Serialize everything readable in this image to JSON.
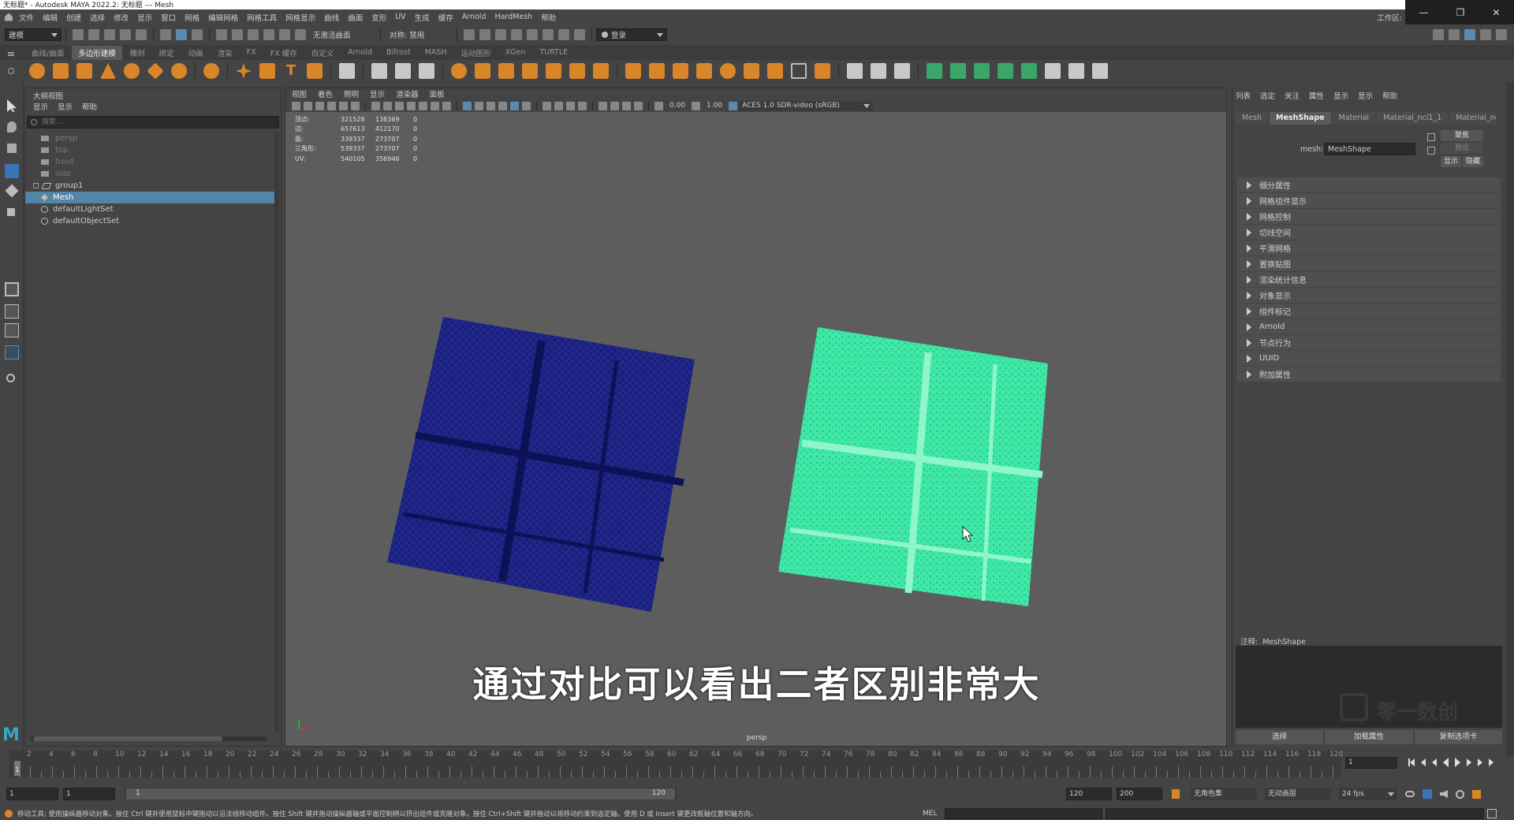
{
  "window": {
    "title": "无标题* - Autodesk MAYA 2022.2: 无标题   ---   Mesh",
    "workspace_label": "工作区:",
    "controls": [
      "—",
      "❐",
      "✕"
    ]
  },
  "menubar": [
    "文件",
    "编辑",
    "创建",
    "选择",
    "修改",
    "显示",
    "窗口",
    "网格",
    "编辑网格",
    "网格工具",
    "网格显示",
    "曲线",
    "曲面",
    "变形",
    "UV",
    "生成",
    "缓存",
    "Arnold",
    "HardMesh",
    "帮助"
  ],
  "status_line": {
    "mode": "建模",
    "live_surface": "无激活曲面",
    "symmetry": "对称: 禁用",
    "login": "登录"
  },
  "shelf_tabs": [
    "曲线/曲面",
    "多边形建模",
    "雕刻",
    "绑定",
    "动画",
    "渲染",
    "FX",
    "FX 缓存",
    "自定义",
    "Arnold",
    "Bifrost",
    "MASH",
    "运动图形",
    "XGen",
    "TURTLE"
  ],
  "shelf_active": "多边形建模",
  "outliner": {
    "title": "大纲视图",
    "menus": [
      "显示",
      "显示",
      "帮助"
    ],
    "search_placeholder": "搜索...",
    "items": [
      {
        "label": "persp",
        "dim": true,
        "icon": "camera-icon"
      },
      {
        "label": "top",
        "dim": true,
        "icon": "camera-icon"
      },
      {
        "label": "front",
        "dim": true,
        "icon": "camera-icon"
      },
      {
        "label": "side",
        "dim": true,
        "icon": "camera-icon"
      },
      {
        "label": "group1",
        "dim": false,
        "icon": "group-icon"
      },
      {
        "label": "Mesh",
        "dim": false,
        "icon": "mesh-icon",
        "selected": true
      },
      {
        "label": "defaultLightSet",
        "dim": false,
        "icon": "set-icon"
      },
      {
        "label": "defaultObjectSet",
        "dim": false,
        "icon": "set-icon"
      }
    ]
  },
  "viewport": {
    "menus": [
      "视图",
      "着色",
      "照明",
      "显示",
      "渲染器",
      "面板"
    ],
    "exposure": "0.00",
    "gamma": "1.00",
    "colorspace": "ACES 1.0 SDR-video (sRGB)",
    "camera_label": "persp",
    "hud": [
      [
        "顶点:",
        "321528",
        "138369",
        "0"
      ],
      [
        "边:",
        "657613",
        "412170",
        "0"
      ],
      [
        "面:",
        "339337",
        "273707",
        "0"
      ],
      [
        "三角形:",
        "539337",
        "273707",
        "0"
      ],
      [
        "UV:",
        "540105",
        "356946",
        "0"
      ]
    ],
    "subtitle": "通过对比可以看出二者区别非常大",
    "mesh_colors": {
      "left": "#1a1f7a",
      "right": "#3ee8a6"
    }
  },
  "attribute_editor": {
    "menus": [
      "列表",
      "选定",
      "关注",
      "属性",
      "显示",
      "显示",
      "帮助"
    ],
    "tabs": [
      "Mesh",
      "MeshShape",
      "Material",
      "Material_ncl1_1",
      "Material_ncl1"
    ],
    "active_tab": "MeshShape",
    "mesh_label": "mesh:",
    "mesh_value": "MeshShape",
    "side_buttons": [
      "聚焦",
      "预设",
      "显示",
      "隐藏"
    ],
    "sections": [
      "细分属性",
      "网格组件显示",
      "网格控制",
      "切线空间",
      "平滑网格",
      "置换贴图",
      "渲染统计信息",
      "对象显示",
      "组件标记",
      "Arnold",
      "节点行为",
      "UUID",
      "附加属性"
    ],
    "notes_label": "注释:  MeshShape",
    "bottom_buttons": [
      "选择",
      "加载属性",
      "复制选项卡"
    ],
    "watermark": "零一数创"
  },
  "timeline": {
    "ticks": [
      "2",
      "4",
      "6",
      "8",
      "10",
      "12",
      "14",
      "16",
      "18",
      "20",
      "22",
      "24",
      "26",
      "28",
      "30",
      "32",
      "34",
      "36",
      "38",
      "40",
      "42",
      "44",
      "46",
      "48",
      "50",
      "52",
      "54",
      "56",
      "58",
      "60",
      "62",
      "64",
      "66",
      "68",
      "70",
      "72",
      "74",
      "76",
      "78",
      "80",
      "82",
      "84",
      "86",
      "88",
      "90",
      "92",
      "94",
      "96",
      "98",
      "100",
      "102",
      "104",
      "106",
      "108",
      "110",
      "112",
      "114",
      "116",
      "118",
      "120"
    ],
    "current_frame": "1",
    "frame_field": "1"
  },
  "range": {
    "start": "1",
    "start2": "1",
    "slider_start": "1",
    "slider_end": "120",
    "end": "120",
    "end2": "200",
    "character_set": "无角色集",
    "anim_layer": "无动画层",
    "fps": "24 fps"
  },
  "help_line": {
    "text": "移动工具: 使用操纵器移动对象。按住 Ctrl 键并使用鼠标中键拖动以沿法线移动组件。按住 Shift 键并拖动操纵器轴或平面控制柄以挤出组件或克隆对象。按住 Ctrl+Shift 键并拖动以将移动约束到选定轴。使用 D 或 Insert 键更改枢轴位置和轴方向。",
    "mel_label": "MEL"
  }
}
